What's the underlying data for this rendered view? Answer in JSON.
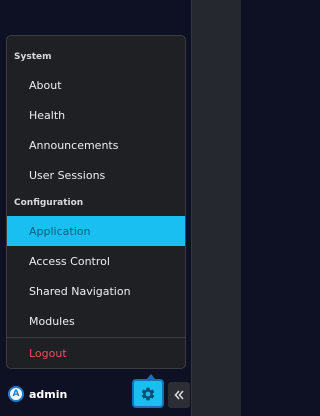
{
  "menu": {
    "sections": [
      {
        "header": "System",
        "items": [
          "About",
          "Health",
          "Announcements",
          "User Sessions"
        ]
      },
      {
        "header": "Configuration",
        "items": [
          "Application",
          "Access Control",
          "Shared Navigation",
          "Modules"
        ]
      }
    ],
    "active_item": "Application",
    "logout_label": "Logout"
  },
  "footer": {
    "avatar_letter": "A",
    "username": "admin"
  },
  "icons": {
    "settings": "gear-icon",
    "collapse": "double-chevron-left-icon"
  },
  "colors": {
    "accent": "#18bff0",
    "logout": "#e8505b",
    "menu_bg": "#1f2024",
    "sidebar_bg": "#0e1124"
  }
}
